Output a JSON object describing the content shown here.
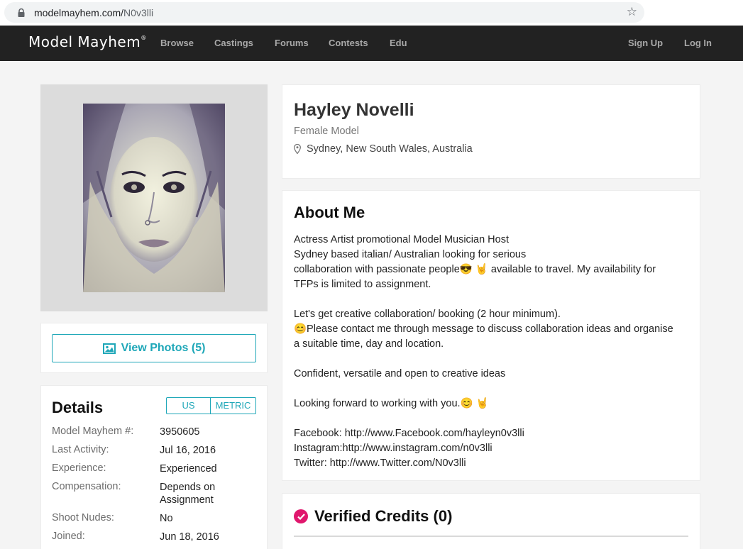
{
  "browser": {
    "url_host": "modelmayhem.com/",
    "url_path": "N0v3lli"
  },
  "nav": {
    "logo": "Model Mayhem",
    "logo_mark": "®",
    "links": [
      "Browse",
      "Castings",
      "Forums",
      "Contests",
      "Edu"
    ],
    "sign_up": "Sign Up",
    "log_in": "Log In"
  },
  "sidebar": {
    "view_photos": "View Photos (5)",
    "details_title": "Details",
    "unit_us": "US",
    "unit_metric": "METRIC",
    "details": [
      {
        "label": "Model Mayhem #:",
        "value": "3950605"
      },
      {
        "label": "Last Activity:",
        "value": "Jul 16, 2016"
      },
      {
        "label": "Experience:",
        "value": "Experienced"
      },
      {
        "label": "Compensation:",
        "value": "Depends on Assignment"
      },
      {
        "label": "Shoot Nudes:",
        "value": "No"
      },
      {
        "label": "Joined:",
        "value": "Jun 18, 2016"
      }
    ]
  },
  "profile": {
    "name": "Hayley Novelli",
    "role": "Female Model",
    "location": "Sydney, New South Wales, Australia"
  },
  "about": {
    "title": "About Me",
    "lines": [
      "Actress Artist promotional Model Musician Host",
      "Sydney based italian/ Australian looking for serious",
      "collaboration with passionate people😎 🤘  available to travel. My availability for",
      "TFPs is limited to assignment.",
      "",
      "Let's get creative collaboration/ booking (2 hour minimum).",
      "😊Please contact me through message to discuss collaboration ideas and organise",
      "a suitable time, day and location.",
      "",
      "Confident, versatile and open to creative ideas",
      "",
      "Looking forward to working with you.😊 🤘",
      "",
      "Facebook: http://www.Facebook.com/hayleyn0v3lli",
      "Instagram:http://www.instagram.com/n0v3lli",
      "Twitter: http://www.Twitter.com/N0v3lli"
    ]
  },
  "credits": {
    "title": "Verified Credits (0)"
  },
  "colors": {
    "accent": "#1ea7b8",
    "nav_bg": "#222222",
    "verified": "#e0176d"
  }
}
